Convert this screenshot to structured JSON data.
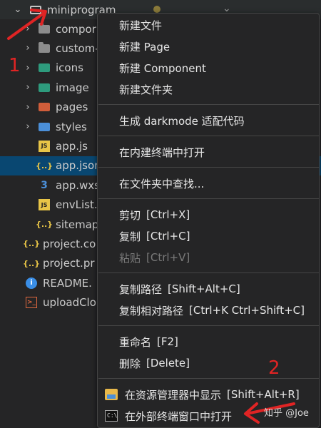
{
  "explorer": {
    "root": {
      "label": "miniprogram"
    },
    "items": [
      {
        "label": "compor",
        "icon": "folder-icon"
      },
      {
        "label": "custom-",
        "icon": "folder-icon"
      },
      {
        "label": "icons",
        "icon": "folder-icons-icon"
      },
      {
        "label": "image",
        "icon": "folder-image-icon"
      },
      {
        "label": "pages",
        "icon": "folder-pages-icon"
      },
      {
        "label": "styles",
        "icon": "folder-styles-icon"
      },
      {
        "label": "app.js",
        "icon": "js-file-icon",
        "badge": "JS"
      },
      {
        "label": "app.json",
        "icon": "json-file-icon",
        "badge": "{..}"
      },
      {
        "label": "app.wxs",
        "icon": "css-file-icon",
        "badge": "3"
      },
      {
        "label": "envList.j",
        "icon": "js-file-icon",
        "badge": "JS"
      },
      {
        "label": "sitemap",
        "icon": "json-file-icon",
        "badge": "{..}"
      },
      {
        "label": "project.co",
        "icon": "json-file-icon",
        "badge": "{..}"
      },
      {
        "label": "project.pr",
        "icon": "json-file-icon",
        "badge": "{..}"
      },
      {
        "label": "README.",
        "icon": "info-file-icon",
        "badge": "i"
      },
      {
        "label": "uploadClo",
        "icon": "powershell-file-icon",
        "badge": ">_"
      }
    ]
  },
  "context_menu": {
    "groups": [
      [
        {
          "label": "新建文件"
        },
        {
          "label": "新建 Page"
        },
        {
          "label": "新建 Component"
        },
        {
          "label": "新建文件夹"
        }
      ],
      [
        {
          "label": "生成 darkmode 适配代码"
        }
      ],
      [
        {
          "label": "在内建终端中打开"
        }
      ],
      [
        {
          "label": "在文件夹中查找..."
        }
      ],
      [
        {
          "label": "剪切",
          "shortcut": "[Ctrl+X]"
        },
        {
          "label": "复制",
          "shortcut": "[Ctrl+C]"
        },
        {
          "label": "粘贴",
          "shortcut": "[Ctrl+V]",
          "disabled": true
        }
      ],
      [
        {
          "label": "复制路径",
          "shortcut": "[Shift+Alt+C]"
        },
        {
          "label": "复制相对路径",
          "shortcut": "[Ctrl+K Ctrl+Shift+C]"
        }
      ],
      [
        {
          "label": "重命名",
          "shortcut": "[F2]"
        },
        {
          "label": "删除",
          "shortcut": "[Delete]"
        }
      ],
      [
        {
          "label": "在资源管理器中显示",
          "shortcut": "[Shift+Alt+R]",
          "icon": "file-explorer-icon"
        },
        {
          "label": "在外部终端窗口中打开",
          "icon": "terminal-icon",
          "terminal_glyph": "C:\\"
        }
      ]
    ]
  },
  "annotations": {
    "mark_1": "1",
    "mark_2": "2",
    "color": "#e02424"
  },
  "watermark": "知乎 @Joe"
}
